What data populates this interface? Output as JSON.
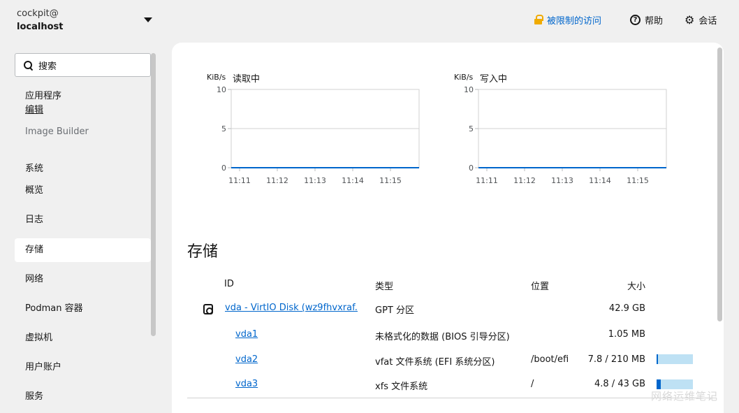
{
  "host": {
    "user": "cockpit@",
    "name": "localhost"
  },
  "topbar": {
    "access": "被限制的访问",
    "help": "帮助",
    "session": "会话"
  },
  "sidebar": {
    "search_placeholder": "搜索",
    "apps_heading": "应用程序",
    "edit": "编辑",
    "image_builder": "Image Builder",
    "system_heading": "系统",
    "items": [
      "概览",
      "日志",
      "存储",
      "网络",
      "Podman 容器",
      "虚拟机",
      "用户账户",
      "服务"
    ],
    "active": "存储"
  },
  "charts": [
    {
      "unit": "KiB/s",
      "title": "读取中",
      "y_ticks": [
        "10",
        "5",
        "0"
      ],
      "x_ticks": [
        "11:11",
        "11:12",
        "11:13",
        "11:14",
        "11:15"
      ]
    },
    {
      "unit": "KiB/s",
      "title": "写入中",
      "y_ticks": [
        "10",
        "5",
        "0"
      ],
      "x_ticks": [
        "11:11",
        "11:12",
        "11:13",
        "11:14",
        "11:15"
      ]
    }
  ],
  "chart_data": [
    {
      "type": "line",
      "title": "读取中",
      "ylabel": "KiB/s",
      "ylim": [
        0,
        10
      ],
      "x": [
        "11:11",
        "11:12",
        "11:13",
        "11:14",
        "11:15"
      ],
      "values": [
        0,
        0,
        0,
        0,
        0
      ]
    },
    {
      "type": "line",
      "title": "写入中",
      "ylabel": "KiB/s",
      "ylim": [
        0,
        10
      ],
      "x": [
        "11:11",
        "11:12",
        "11:13",
        "11:14",
        "11:15"
      ],
      "values": [
        0,
        0,
        0,
        0,
        0
      ]
    }
  ],
  "storage": {
    "title": "存储",
    "columns": {
      "id": "ID",
      "type": "类型",
      "location": "位置",
      "size": "大小"
    },
    "rows": [
      {
        "id": "vda - VirtIO Disk (wz9fhvxraf...",
        "type": "GPT 分区",
        "location": "",
        "size": "42.9 GB"
      },
      {
        "id": "vda1",
        "type": "未格式化的数据 (BIOS 引导分区)",
        "location": "",
        "size": "1.05 MB"
      },
      {
        "id": "vda2",
        "type": "vfat 文件系统 (EFI 系统分区)",
        "location": "/boot/efi",
        "size": "7.8 / 210 MB",
        "usage": 0.037
      },
      {
        "id": "vda3",
        "type": "xfs 文件系统",
        "location": "/",
        "size": "4.8 / 43 GB",
        "usage": 0.112
      }
    ]
  },
  "watermark": "网络运维笔记",
  "colors": {
    "link": "#0066cc",
    "lock": "#f0ab00",
    "usage_fill": "#0066cc",
    "usage_track": "#bee1f4",
    "chart_line": "#0066cc"
  }
}
